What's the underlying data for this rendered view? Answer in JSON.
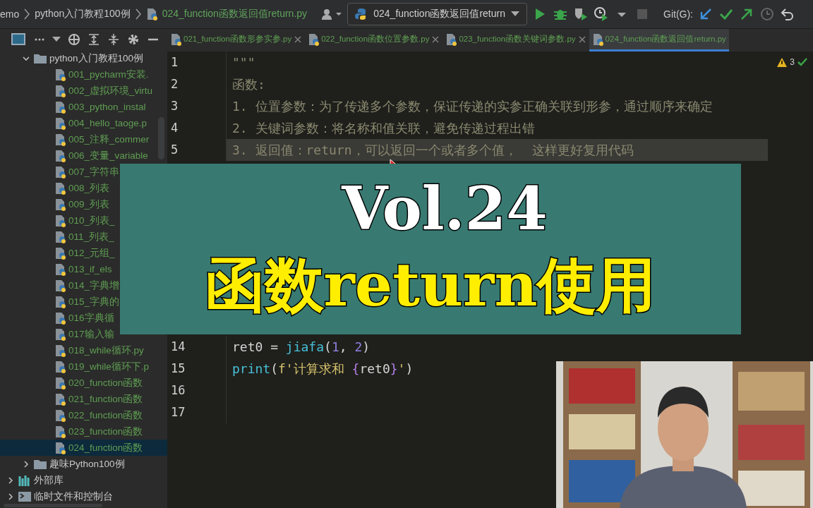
{
  "breadcrumb": [
    {
      "label": "emo",
      "kind": "project"
    },
    {
      "label": "python入门教程100例",
      "kind": "folder"
    },
    {
      "label": "024_function函数返回值return.py",
      "kind": "file"
    }
  ],
  "run_config": "024_function函数返回值return",
  "git_label": "Git(G):",
  "tabs": [
    {
      "label": "021_function函数形参实参.py",
      "selected": false
    },
    {
      "label": "022_function函数位置参数.py",
      "selected": false
    },
    {
      "label": "023_function函数关键词参数.py",
      "selected": false
    },
    {
      "label": "024_function函数返回值return.py",
      "selected": true
    }
  ],
  "tree": [
    {
      "label": "python入门教程100例",
      "kind": "folder",
      "expanded": true,
      "children": [
        {
          "label": "001_pycharm安装.",
          "kind": "file",
          "selected": false
        },
        {
          "label": "002_虚拟环境_virtu",
          "kind": "file",
          "selected": false
        },
        {
          "label": "003_python_instal",
          "kind": "file",
          "selected": false
        },
        {
          "label": "004_hello_taoge.p",
          "kind": "file",
          "selected": false
        },
        {
          "label": "005_注释_commer",
          "kind": "file",
          "selected": false
        },
        {
          "label": "006_变量_variable",
          "kind": "file",
          "selected": false
        },
        {
          "label": "007_字符串",
          "kind": "file",
          "selected": false
        },
        {
          "label": "008_列表",
          "kind": "file",
          "selected": false
        },
        {
          "label": "009_列表",
          "kind": "file",
          "selected": false
        },
        {
          "label": "010_列表_",
          "kind": "file",
          "selected": false
        },
        {
          "label": "011_列表_",
          "kind": "file",
          "selected": false
        },
        {
          "label": "012_元组_",
          "kind": "file",
          "selected": false
        },
        {
          "label": "013_if_els",
          "kind": "file",
          "selected": false
        },
        {
          "label": "014_字典增",
          "kind": "file",
          "selected": false
        },
        {
          "label": "015_字典的",
          "kind": "file",
          "selected": false
        },
        {
          "label": "016字典循",
          "kind": "file",
          "selected": false
        },
        {
          "label": "017输入输",
          "kind": "file",
          "selected": false
        },
        {
          "label": "018_while循环.py",
          "kind": "file",
          "selected": false
        },
        {
          "label": "019_while循环下.p",
          "kind": "file",
          "selected": false
        },
        {
          "label": "020_function函数",
          "kind": "file",
          "selected": false
        },
        {
          "label": "021_function函数",
          "kind": "file",
          "selected": false
        },
        {
          "label": "022_function函数",
          "kind": "file",
          "selected": false
        },
        {
          "label": "023_function函数",
          "kind": "file",
          "selected": false
        },
        {
          "label": "024_function函数",
          "kind": "file",
          "selected": true
        }
      ]
    },
    {
      "label": "趣味Python100例",
      "kind": "folder",
      "expanded": false
    },
    {
      "label": "外部库",
      "kind": "library",
      "expanded": false
    },
    {
      "label": "临时文件和控制台",
      "kind": "console",
      "expanded": false
    }
  ],
  "editor": {
    "warnings": "3",
    "lines_above": [
      {
        "number": "1",
        "highlighted": false,
        "tokens": [
          {
            "text": "\"\"\"",
            "kind": "doc"
          }
        ]
      },
      {
        "number": "2",
        "highlighted": false,
        "tokens": [
          {
            "text": "函数:",
            "kind": "doc"
          }
        ]
      },
      {
        "number": "3",
        "highlighted": false,
        "tokens": [
          {
            "text": "1. 位置参数：为了传递多个参数，保证传递的实参正确关联到形参，通过顺序来确定",
            "kind": "doc"
          }
        ]
      },
      {
        "number": "4",
        "highlighted": false,
        "tokens": [
          {
            "text": "2. 关键词参数：将名称和值关联，避免传递过程出错",
            "kind": "doc"
          }
        ]
      },
      {
        "number": "5",
        "highlighted": true,
        "tokens": [
          {
            "text": "3. 返回值：return，可以返回一个或者多个值，  这样更好复用代码",
            "kind": "doc"
          }
        ]
      }
    ],
    "lines_below": [
      {
        "number": "14",
        "highlighted": false,
        "tokens": [
          {
            "text": "ret0 = ",
            "kind": "plain"
          },
          {
            "text": "jiafa",
            "kind": "call"
          },
          {
            "text": "(",
            "kind": "plain"
          },
          {
            "text": "1",
            "kind": "number"
          },
          {
            "text": ", ",
            "kind": "plain"
          },
          {
            "text": "2",
            "kind": "number"
          },
          {
            "text": ")",
            "kind": "plain"
          }
        ]
      },
      {
        "number": "15",
        "highlighted": false,
        "tokens": [
          {
            "text": "print",
            "kind": "call"
          },
          {
            "text": "(",
            "kind": "plain"
          },
          {
            "text": "f'计算求和 ",
            "kind": "string"
          },
          {
            "text": "{",
            "kind": "brace"
          },
          {
            "text": "ret0",
            "kind": "plain"
          },
          {
            "text": "}",
            "kind": "brace"
          },
          {
            "text": "'",
            "kind": "string"
          },
          {
            "text": ")",
            "kind": "plain"
          }
        ]
      },
      {
        "number": "16",
        "highlighted": false
      },
      {
        "number": "17",
        "highlighted": false
      }
    ]
  },
  "banner": {
    "title": "Vol.24",
    "subtitle": "函数return使用"
  }
}
